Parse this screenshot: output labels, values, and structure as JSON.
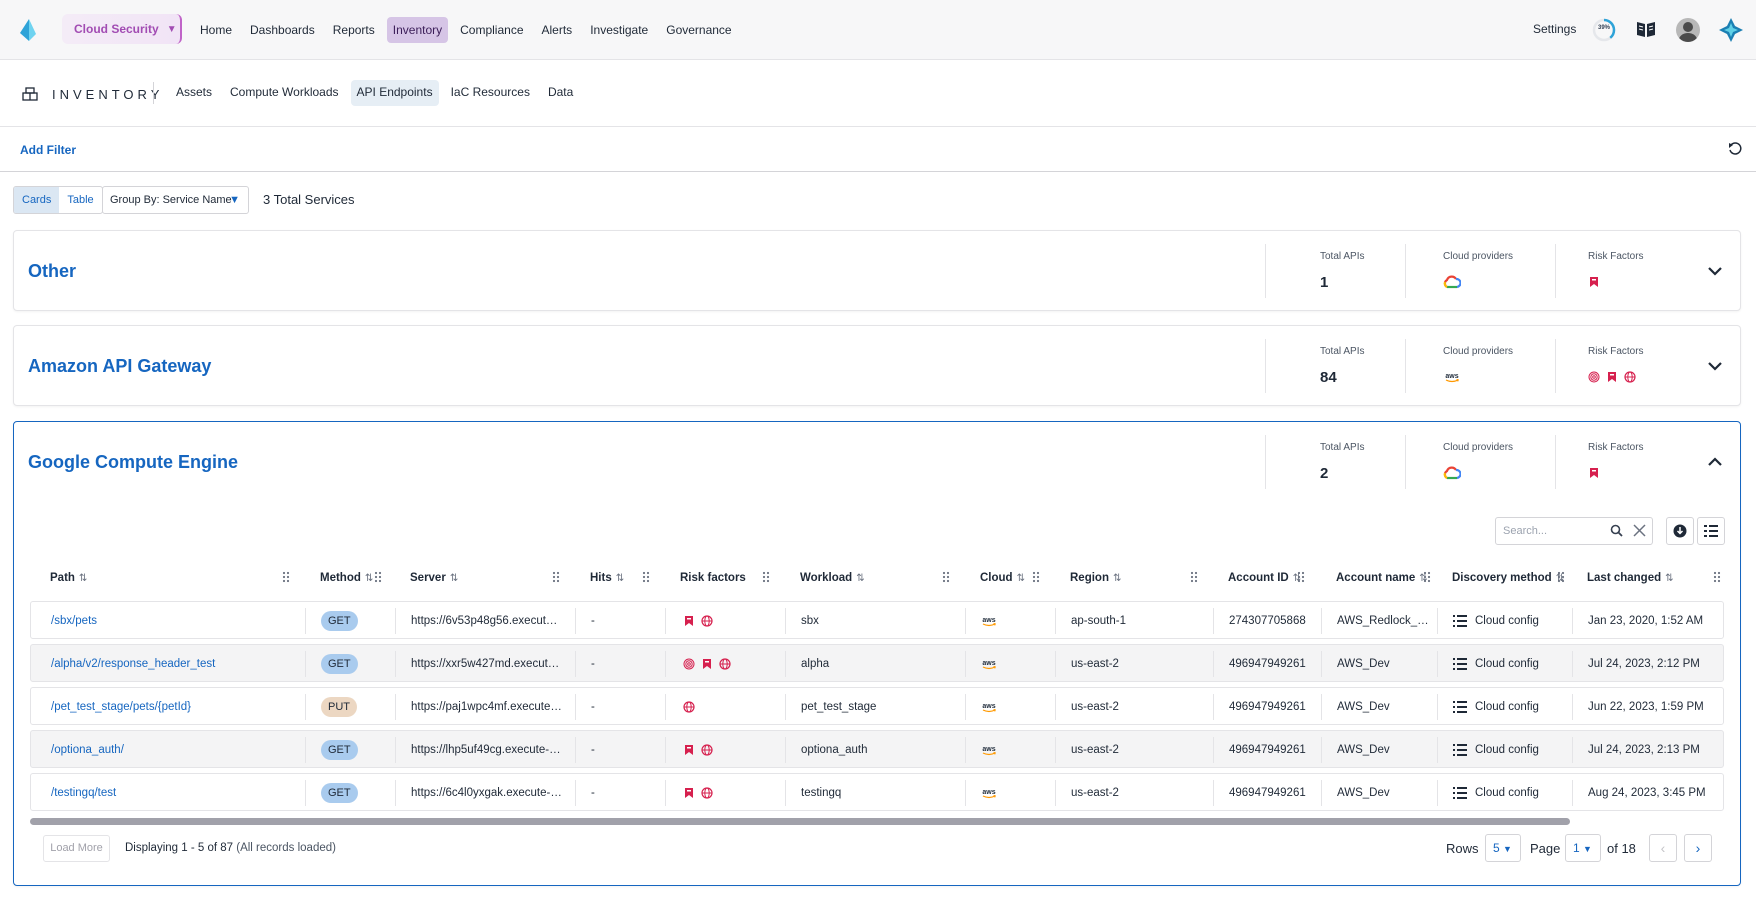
{
  "topnav": {
    "product_switcher": "Cloud Security",
    "items": [
      "Home",
      "Dashboards",
      "Reports",
      "Inventory",
      "Compliance",
      "Alerts",
      "Investigate",
      "Governance"
    ],
    "active_item": "Inventory",
    "settings": "Settings",
    "progress_percent": "39%"
  },
  "subnav": {
    "section_title": "INVENTORY",
    "tabs": [
      "Assets",
      "Compute Workloads",
      "API Endpoints",
      "IaC Resources",
      "Data"
    ],
    "active_tab": "API Endpoints"
  },
  "filterbar": {
    "add_filter": "Add Filter"
  },
  "toolbar": {
    "views": [
      "Cards",
      "Table"
    ],
    "active_view": "Cards",
    "group_by": "Group By: Service Name",
    "total": "3 Total Services"
  },
  "services": [
    {
      "name": "Other",
      "total_apis_label": "Total APIs",
      "total_apis": "1",
      "cloud_label": "Cloud providers",
      "cloud": "gcp",
      "risk_label": "Risk Factors",
      "risk_icons": [
        "bookmark-risk"
      ],
      "expanded": false
    },
    {
      "name": "Amazon API Gateway",
      "total_apis_label": "Total APIs",
      "total_apis": "84",
      "cloud_label": "Cloud providers",
      "cloud": "aws",
      "risk_label": "Risk Factors",
      "risk_icons": [
        "fingerprint-risk",
        "bookmark-risk",
        "globe-risk"
      ],
      "expanded": false
    },
    {
      "name": "Google Compute Engine",
      "total_apis_label": "Total APIs",
      "total_apis": "2",
      "cloud_label": "Cloud providers",
      "cloud": "gcp",
      "risk_label": "Risk Factors",
      "risk_icons": [
        "bookmark-risk"
      ],
      "expanded": true
    }
  ],
  "table": {
    "search_placeholder": "Search...",
    "columns": [
      "Path",
      "Method",
      "Server",
      "Hits",
      "Risk factors",
      "Workload",
      "Cloud",
      "Region",
      "Account ID",
      "Account name",
      "Discovery method",
      "Last changed"
    ],
    "rows": [
      {
        "path": "/sbx/pets",
        "method": "GET",
        "server": "https://6v53p48g56.execute-...",
        "hits": "-",
        "risk": [
          "bookmark-risk",
          "globe-risk"
        ],
        "workload": "sbx",
        "cloud": "aws",
        "region": "ap-south-1",
        "account_id": "274307705868",
        "account_name": "AWS_Redlock_S...",
        "discovery": "Cloud config",
        "last_changed": "Jan 23, 2020, 1:52 AM"
      },
      {
        "path": "/alpha/v2/response_header_test",
        "method": "GET",
        "server": "https://xxr5w427md.execute-...",
        "hits": "-",
        "risk": [
          "fingerprint-risk",
          "bookmark-risk",
          "globe-risk"
        ],
        "workload": "alpha",
        "cloud": "aws",
        "region": "us-east-2",
        "account_id": "496947949261",
        "account_name": "AWS_Dev",
        "discovery": "Cloud config",
        "last_changed": "Jul 24, 2023, 2:12 PM"
      },
      {
        "path": "/pet_test_stage/pets/{petId}",
        "method": "PUT",
        "server": "https://paj1wpc4mf.execute-a...",
        "hits": "-",
        "risk": [
          "globe-risk"
        ],
        "workload": "pet_test_stage",
        "cloud": "aws",
        "region": "us-east-2",
        "account_id": "496947949261",
        "account_name": "AWS_Dev",
        "discovery": "Cloud config",
        "last_changed": "Jun 22, 2023, 1:59 PM"
      },
      {
        "path": "/optiona_auth/",
        "method": "GET",
        "server": "https://lhp5uf49cg.execute-ap...",
        "hits": "-",
        "risk": [
          "bookmark-risk",
          "globe-risk"
        ],
        "workload": "optiona_auth",
        "cloud": "aws",
        "region": "us-east-2",
        "account_id": "496947949261",
        "account_name": "AWS_Dev",
        "discovery": "Cloud config",
        "last_changed": "Jul 24, 2023, 2:13 PM"
      },
      {
        "path": "/testingq/test",
        "method": "GET",
        "server": "https://6c4l0yxgak.execute-ap...",
        "hits": "-",
        "risk": [
          "bookmark-risk",
          "globe-risk"
        ],
        "workload": "testingq",
        "cloud": "aws",
        "region": "us-east-2",
        "account_id": "496947949261",
        "account_name": "AWS_Dev",
        "discovery": "Cloud config",
        "last_changed": "Aug 24, 2023, 3:45 PM"
      }
    ],
    "load_more": "Load More",
    "displaying": "Displaying 1 - 5 of 87",
    "records_note": "(All records loaded)",
    "rows_label": "Rows",
    "rows_value": "5",
    "page_label": "Page",
    "page_value": "1",
    "of_pages": "of 18"
  },
  "colors": {
    "accent": "#1666c0",
    "risk": "#d6204e",
    "nav_active": "#d6c5e6",
    "product": "#a24cb3"
  }
}
